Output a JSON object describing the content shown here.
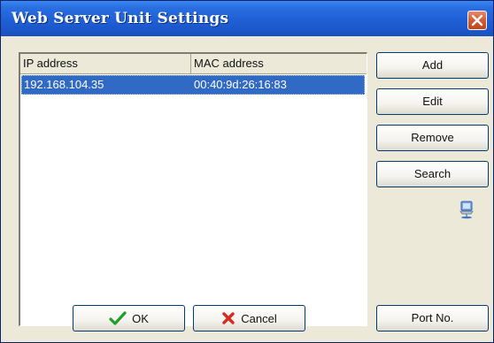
{
  "window": {
    "title": "Web Server Unit Settings"
  },
  "list": {
    "columns": [
      "IP address",
      "MAC address"
    ],
    "rows": [
      {
        "ip": "192.168.104.35",
        "mac": "00:40:9d:26:16:83",
        "selected": true
      }
    ]
  },
  "buttons": {
    "add": "Add",
    "edit": "Edit",
    "remove": "Remove",
    "search": "Search",
    "ok": "OK",
    "cancel": "Cancel",
    "port": "Port No."
  },
  "icons": {
    "close": "close-icon",
    "ok": "checkmark-icon",
    "cancel": "x-icon",
    "network": "network-computer-icon"
  },
  "colors": {
    "titlebar": "#1f5fd6",
    "selection": "#316ac5",
    "close_button": "#d65a35",
    "ok_check": "#1f9e2a",
    "cancel_x": "#d62b1f"
  }
}
